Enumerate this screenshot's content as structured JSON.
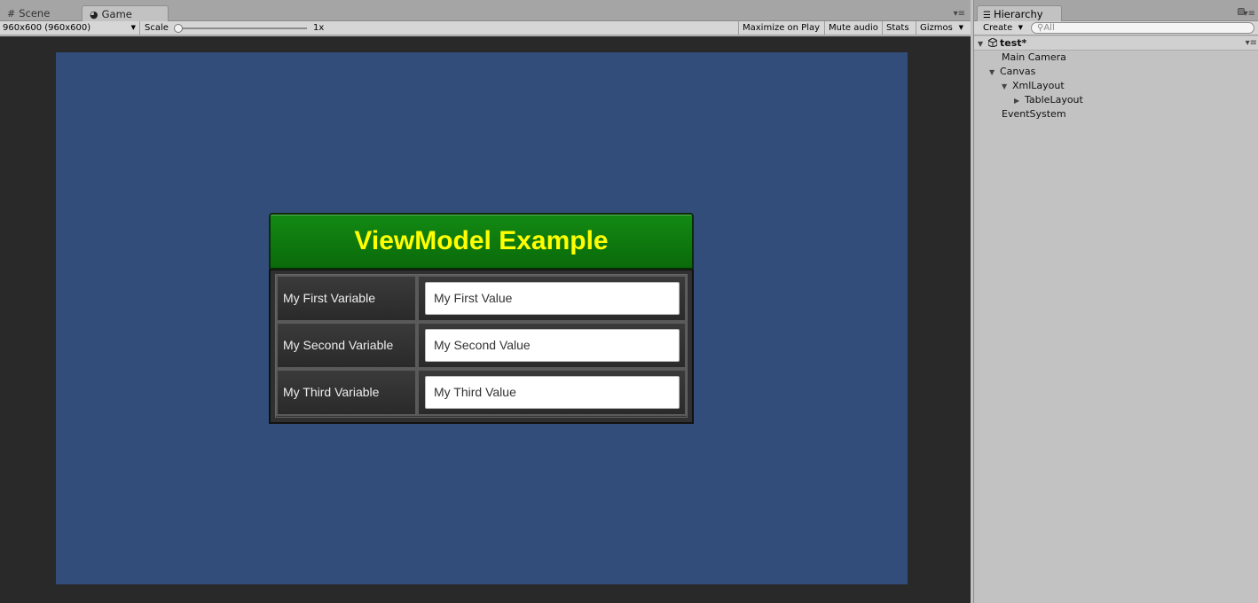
{
  "game_window": {
    "tabs": [
      {
        "label": "Scene",
        "icon": "grid-icon"
      },
      {
        "label": "Game",
        "icon": "pacman-icon"
      }
    ],
    "toolbar": {
      "resolution": "960x600 (960x600)",
      "scale_label": "Scale",
      "scale_value": "1x",
      "buttons": [
        "Maximize on Play",
        "Mute audio",
        "Stats",
        "Gizmos"
      ]
    }
  },
  "viewmodel_panel": {
    "title": "ViewModel Example",
    "rows": [
      {
        "label": "My First Variable",
        "value": "My First Value"
      },
      {
        "label": "My Second Variable",
        "value": "My Second Value"
      },
      {
        "label": "My Third Variable",
        "value": "My Third Value"
      }
    ]
  },
  "hierarchy": {
    "tab_label": "Hierarchy",
    "create_label": "Create",
    "search_placeholder": "All",
    "scene_name": "test*",
    "items": [
      {
        "label": "Main Camera",
        "expand": "none"
      },
      {
        "label": "Canvas",
        "expand": "expanded"
      },
      {
        "label": "XmlLayout",
        "expand": "expanded"
      },
      {
        "label": "TableLayout",
        "expand": "collapsed"
      },
      {
        "label": "EventSystem",
        "expand": "none"
      }
    ]
  },
  "colors": {
    "game_background": "#324d7a",
    "header_green": "#0f7a0f",
    "title_yellow": "#ffff00",
    "editor_gray": "#c2c2c2"
  }
}
